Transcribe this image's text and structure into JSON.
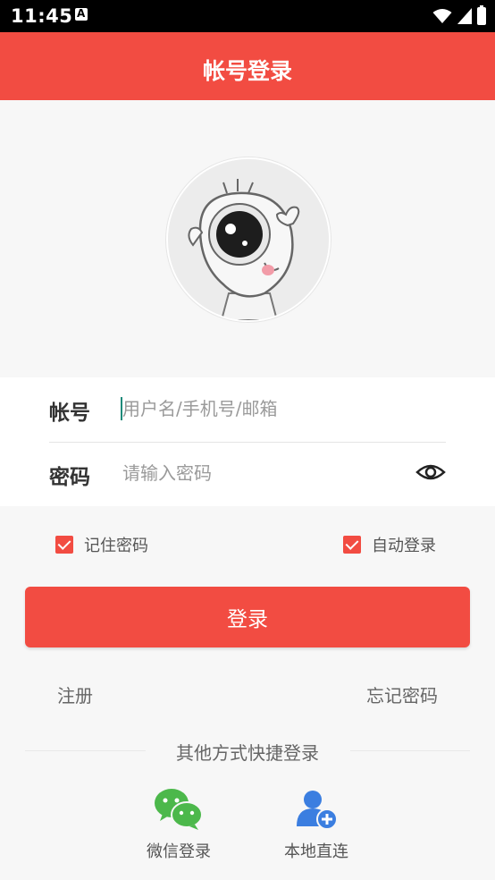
{
  "status_bar": {
    "time": "11:45"
  },
  "app_bar": {
    "title": "帐号登录"
  },
  "form": {
    "account_label": "帐号",
    "account_placeholder": "用户名/手机号/邮箱",
    "password_label": "密码",
    "password_placeholder": "请输入密码"
  },
  "options": {
    "remember_label": "记住密码",
    "remember_checked": true,
    "auto_label": "自动登录",
    "auto_checked": true
  },
  "login_button": "登录",
  "links": {
    "register": "注册",
    "forgot": "忘记密码"
  },
  "other": {
    "divider": "其他方式快捷登录",
    "wechat_label": "微信登录",
    "local_label": "本地直连"
  },
  "colors": {
    "accent": "#f24c42",
    "wechat": "#4cb84b",
    "local": "#3b7ee0"
  }
}
